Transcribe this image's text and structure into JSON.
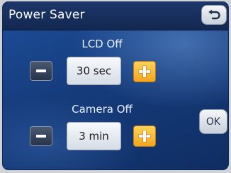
{
  "header": {
    "title": "Power Saver",
    "back_icon": "back-arrow-icon"
  },
  "lcd_off": {
    "label": "LCD Off",
    "value": "30 sec",
    "minus_icon": "minus-icon",
    "plus_icon": "plus-icon"
  },
  "camera_off": {
    "label": "Camera Off",
    "value": "3 min",
    "minus_icon": "minus-icon",
    "plus_icon": "plus-icon"
  },
  "ok_label": "OK",
  "colors": {
    "background": "#163c7c",
    "titlebar": "#122850",
    "plus_accent": "#f3a51e",
    "minus_button": "#26334a"
  }
}
